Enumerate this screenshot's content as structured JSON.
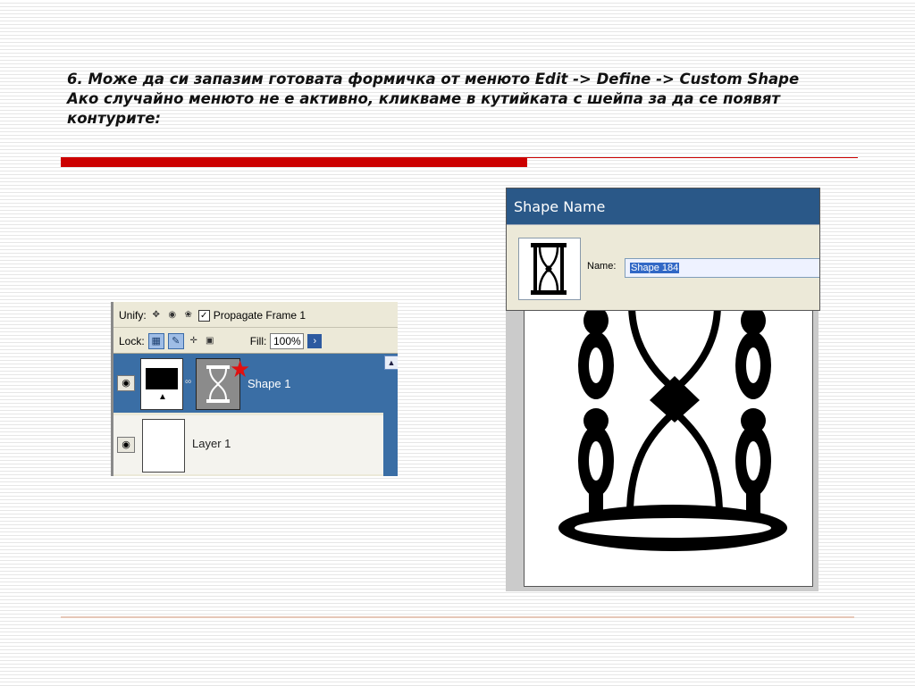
{
  "slide": {
    "heading_line1": "6. Може да си запазим готовата формичка от менюто Edit -> Define -> Custom Shape",
    "heading_line2": "Ако случайно менюто не е активно, кликваме в кутийката с шейпа за да се появят контурите:"
  },
  "layers_panel": {
    "unify_label": "Unify:",
    "propagate_label": "Propagate Frame 1",
    "lock_label": "Lock:",
    "fill_label": "Fill:",
    "fill_value": "100%",
    "layers": [
      {
        "name": "Shape 1",
        "selected": true
      },
      {
        "name": "Layer 1",
        "selected": false
      }
    ]
  },
  "shape_dialog": {
    "title": "Shape Name",
    "name_label": "Name:",
    "name_value": "Shape 184"
  },
  "icons": [
    "eye-icon",
    "link-icon",
    "lock-icon",
    "move-icon",
    "hourglass-icon",
    "star-marker-icon",
    "chevron-up-icon",
    "chevron-right-icon"
  ],
  "colors": {
    "accent_red": "#cc0000",
    "title_bar": "#2a5888",
    "selected_layer": "#3a6ea5"
  }
}
